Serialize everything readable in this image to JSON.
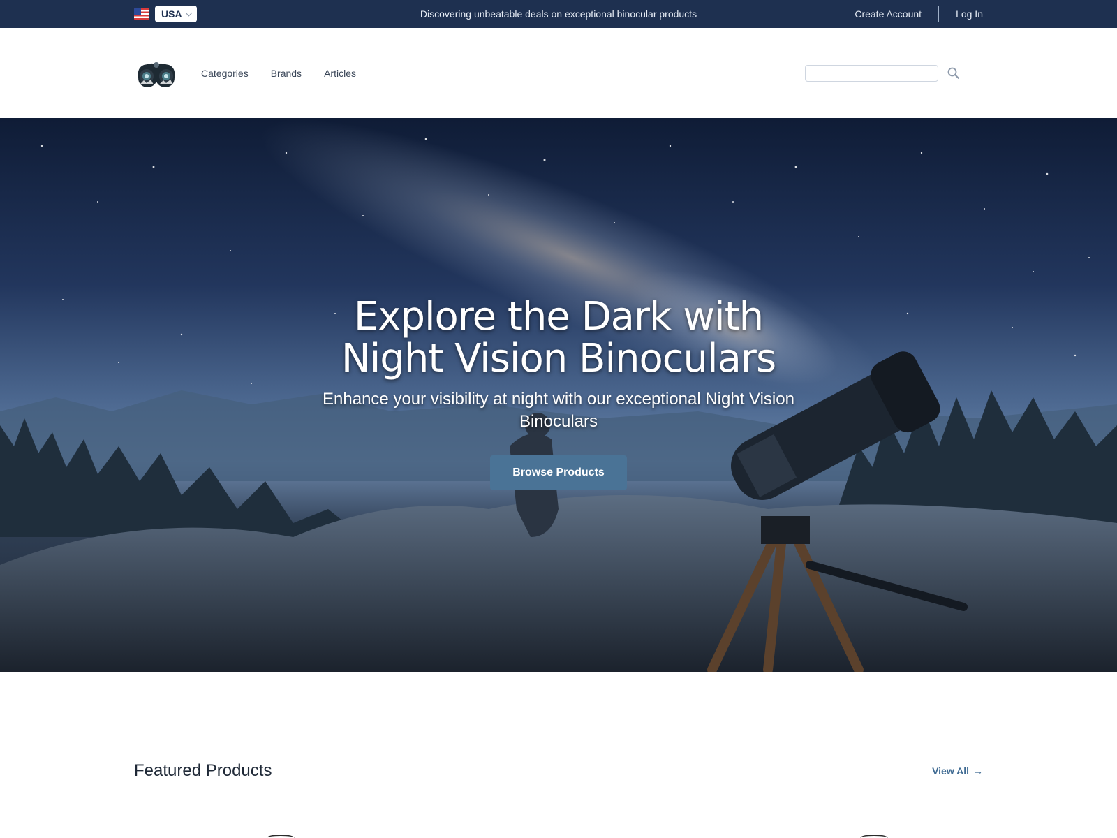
{
  "topbar": {
    "country": "USA",
    "promo": "Discovering unbeatable deals on exceptional binocular products",
    "create_account": "Create Account",
    "login": "Log In"
  },
  "header": {
    "logo_icon": "binoculars-logo-icon",
    "nav": [
      "Categories",
      "Brands",
      "Articles"
    ],
    "search_placeholder": "",
    "search_icon": "search-icon"
  },
  "hero": {
    "title": "Explore the Dark with Night Vision Binoculars",
    "subtitle": "Enhance your visibility at night with our exceptional Night Vision Binoculars",
    "button": "Browse Products"
  },
  "featured": {
    "title": "Featured Products",
    "view_all": "View All",
    "arrow": "→"
  },
  "colors": {
    "topbar_bg": "#1e3050",
    "button_bg": "#4a7396",
    "link": "#3e6a92"
  }
}
